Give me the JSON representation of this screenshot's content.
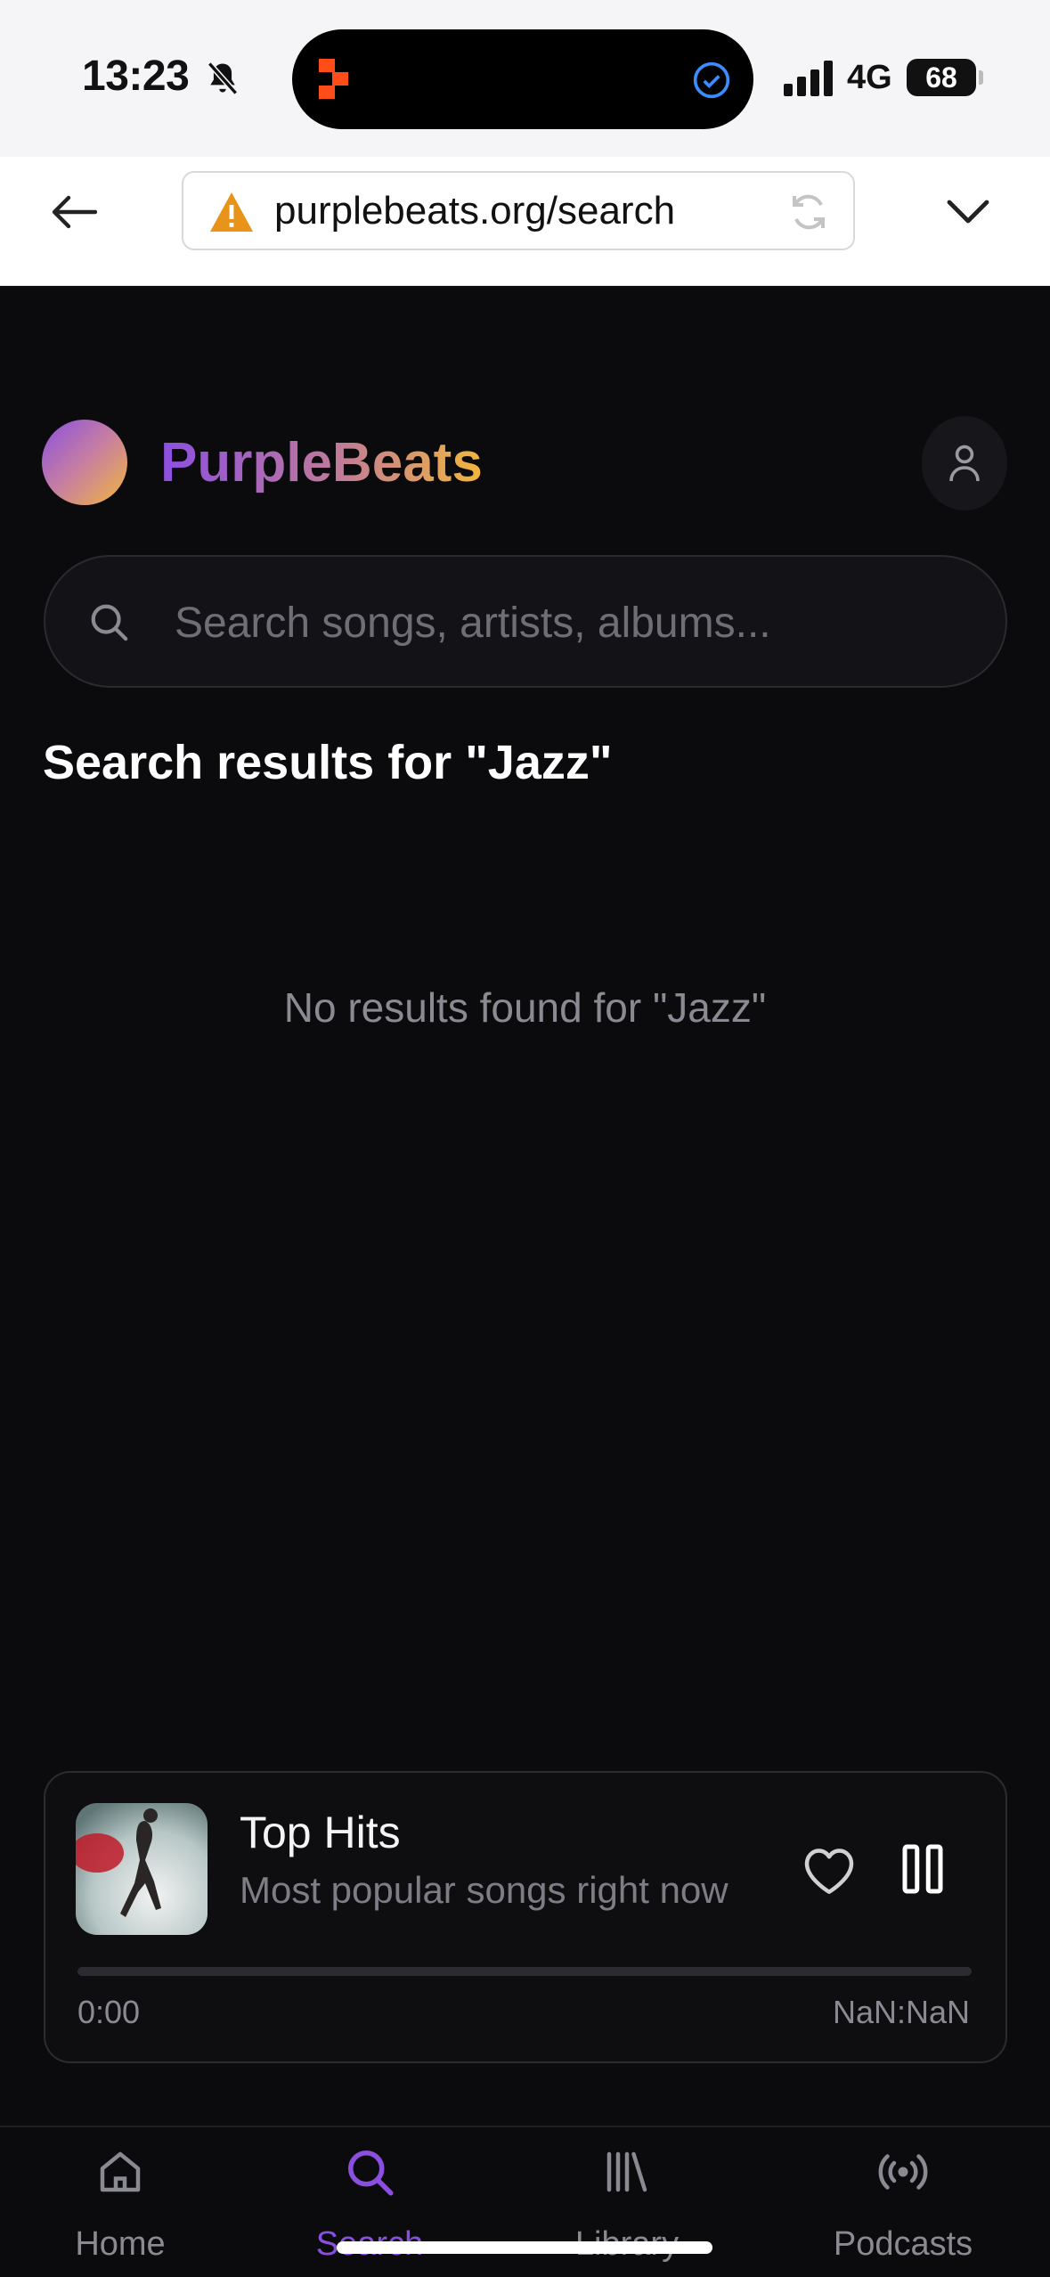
{
  "status": {
    "time": "13:23",
    "network": "4G",
    "battery": "68"
  },
  "browser": {
    "url": "purplebeats.org/search"
  },
  "app": {
    "brand": "PurpleBeats",
    "search_placeholder": "Search songs, artists, albums...",
    "results_title": "Search results for \"Jazz\"",
    "empty_message": "No results found for \"Jazz\""
  },
  "player": {
    "title": "Top Hits",
    "subtitle": "Most popular songs right now",
    "current_time": "0:00",
    "duration": "NaN:NaN",
    "progress": 0
  },
  "nav": {
    "items": [
      {
        "label": "Home",
        "icon": "home-icon"
      },
      {
        "label": "Search",
        "icon": "search-icon"
      },
      {
        "label": "Library",
        "icon": "library-icon"
      },
      {
        "label": "Podcasts",
        "icon": "podcast-icon"
      }
    ],
    "active": "Search"
  },
  "colors": {
    "accent": "#8b4fe0",
    "gold": "#f2b63c",
    "background": "#0b0b0d"
  }
}
